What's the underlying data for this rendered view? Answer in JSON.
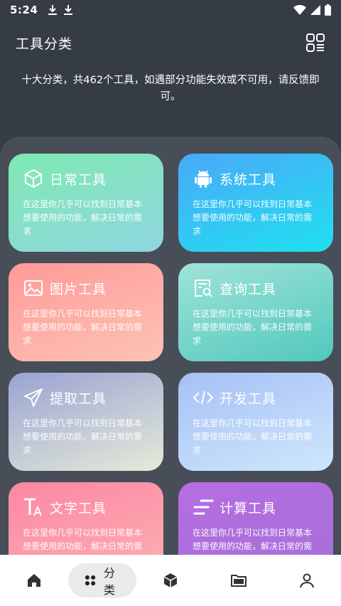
{
  "status": {
    "time": "5:24"
  },
  "appbar": {
    "title": "工具分类"
  },
  "notice": "十大分类，共462个工具，如遇部分功能失效或不可用，请反馈即可。",
  "cards": [
    {
      "name": "日常工具",
      "icon": "cube-icon",
      "desc": "在这里你几乎可以找到日常基本想要使用的功能，解决日常的需求"
    },
    {
      "name": "系统工具",
      "icon": "android-icon",
      "desc": "在这里你几乎可以找到日常基本想要使用的功能，解决日常的需求"
    },
    {
      "name": "图片工具",
      "icon": "image-icon",
      "desc": "在这里你几乎可以找到日常基本想要使用的功能，解决日常的需求"
    },
    {
      "name": "查询工具",
      "icon": "search-doc-icon",
      "desc": "在这里你几乎可以找到日常基本想要使用的功能，解决日常的需求"
    },
    {
      "name": "提取工具",
      "icon": "send-icon",
      "desc": "在这里你几乎可以找到日常基本想要使用的功能，解决日常的需求"
    },
    {
      "name": "开发工具",
      "icon": "code-icon",
      "desc": "在这里你几乎可以找到日常基本想要使用的功能，解决日常的需求"
    },
    {
      "name": "文字工具",
      "icon": "text-icon",
      "desc": "在这里你几乎可以找到日常基本想要使用的功能，解决日常的需求"
    },
    {
      "name": "计算工具",
      "icon": "lines-icon",
      "desc": "在这里你几乎可以找到日常基本想要使用的功能，解决日常的需求"
    }
  ],
  "nav": {
    "active_label": "分类"
  }
}
